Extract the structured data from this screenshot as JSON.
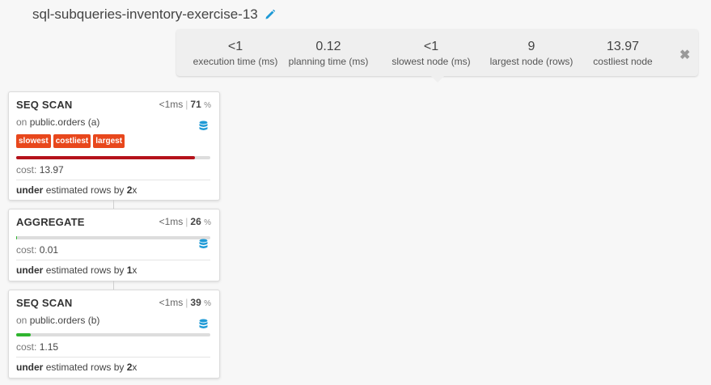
{
  "header": {
    "title": "sql-subqueries-inventory-exercise-13"
  },
  "stats": [
    {
      "value": "<1",
      "label": "execution time (ms)"
    },
    {
      "value": "0.12",
      "label": "planning time (ms)"
    },
    {
      "value": "<1",
      "label": "slowest node (ms)"
    },
    {
      "value": "9",
      "label": "largest node (rows)"
    },
    {
      "value": "13.97",
      "label": "costliest node"
    }
  ],
  "nodes": [
    {
      "type": "SEQ SCAN",
      "time": "<1ms",
      "percent": "71",
      "percent_unit": "%",
      "on_prefix": "on",
      "relation": "public.orders (a)",
      "badges": [
        "slowest",
        "costliest",
        "largest"
      ],
      "bar_fraction": 0.92,
      "bar_color": "#b5121b",
      "cost_label": "cost:",
      "cost": "13.97",
      "est_word": "under",
      "est_text": "estimated rows by",
      "est_factor": "2",
      "est_unit": "x"
    },
    {
      "type": "AGGREGATE",
      "time": "<1ms",
      "percent": "26",
      "percent_unit": "%",
      "bar_fraction": 0.005,
      "bar_color": "#2fb52f",
      "cost_label": "cost:",
      "cost": "0.01",
      "est_word": "under",
      "est_text": "estimated rows by",
      "est_factor": "1",
      "est_unit": "x"
    },
    {
      "type": "SEQ SCAN",
      "time": "<1ms",
      "percent": "39",
      "percent_unit": "%",
      "on_prefix": "on",
      "relation": "public.orders (b)",
      "bar_fraction": 0.075,
      "bar_color": "#2fb52f",
      "cost_label": "cost:",
      "cost": "1.15",
      "est_word": "under",
      "est_text": "estimated rows by",
      "est_factor": "2",
      "est_unit": "x"
    }
  ],
  "icons": {
    "edit": "pencil-icon",
    "close": "close-icon",
    "database": "database-icon"
  },
  "colors": {
    "badge": "#e8471c",
    "icon_blue": "#1e9ad6"
  }
}
